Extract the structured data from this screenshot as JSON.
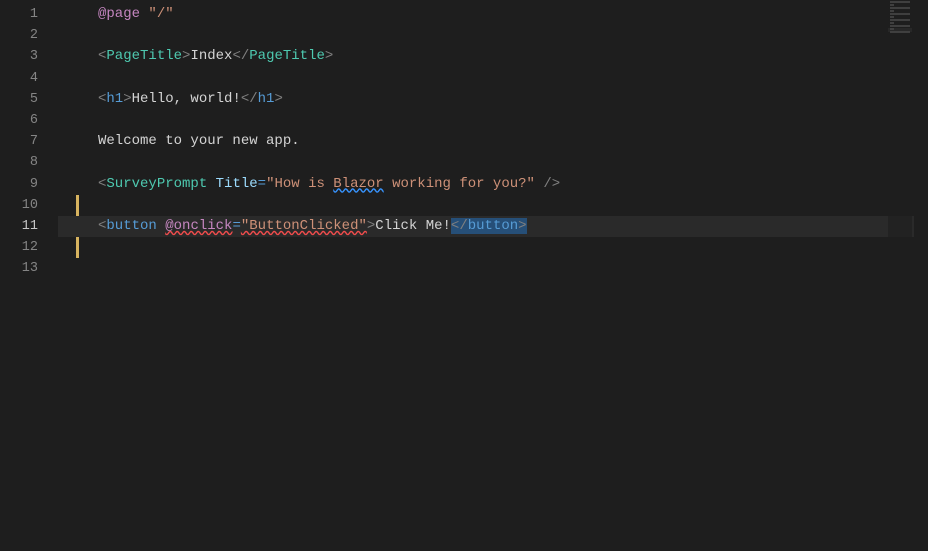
{
  "gutter": {
    "lines": [
      "1",
      "2",
      "3",
      "4",
      "5",
      "6",
      "7",
      "8",
      "9",
      "10",
      "11",
      "12",
      "13"
    ],
    "activeLine": 11
  },
  "code": {
    "line1": {
      "dir": "@page",
      "str": "\"/\""
    },
    "line3": {
      "open": "PageTitle",
      "text": "Index",
      "close": "PageTitle"
    },
    "line5": {
      "open": "h1",
      "text": "Hello, world!",
      "close": "h1"
    },
    "line7": {
      "text": "Welcome to your new app."
    },
    "line9": {
      "comp": "SurveyPrompt",
      "attr": "Title",
      "val": "\"How is ",
      "wavy": "Blazor",
      "val2": " working for you?\""
    },
    "line11": {
      "open": "button",
      "dir": "@onclick",
      "val": "\"ButtonClicked\"",
      "text": "Click Me!",
      "close": "button"
    }
  }
}
